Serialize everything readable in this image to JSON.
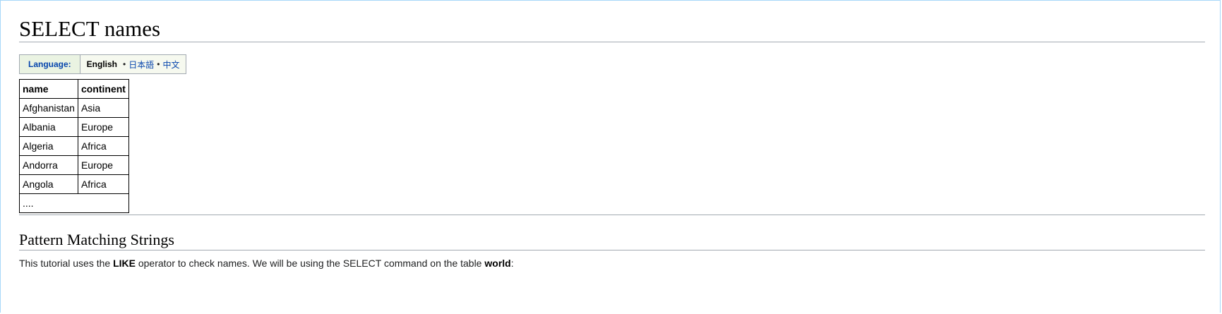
{
  "page": {
    "title": "SELECT names"
  },
  "language_bar": {
    "label": "Language:",
    "current": "English",
    "separator1": "•",
    "separator2": "•",
    "options": [
      "日本語",
      "中文"
    ]
  },
  "result_table": {
    "columns": [
      "name",
      "continent"
    ],
    "rows": [
      [
        "Afghanistan",
        "Asia"
      ],
      [
        "Albania",
        "Europe"
      ],
      [
        "Algeria",
        "Africa"
      ],
      [
        "Andorra",
        "Europe"
      ],
      [
        "Angola",
        "Africa"
      ]
    ],
    "ellipsis": "...."
  },
  "section": {
    "title": "Pattern Matching Strings",
    "intro_part1": "This tutorial uses the ",
    "intro_bold1": "LIKE",
    "intro_part2": " operator to check names. We will be using the SELECT command on the table ",
    "intro_bold2": "world",
    "intro_part3": ":"
  }
}
